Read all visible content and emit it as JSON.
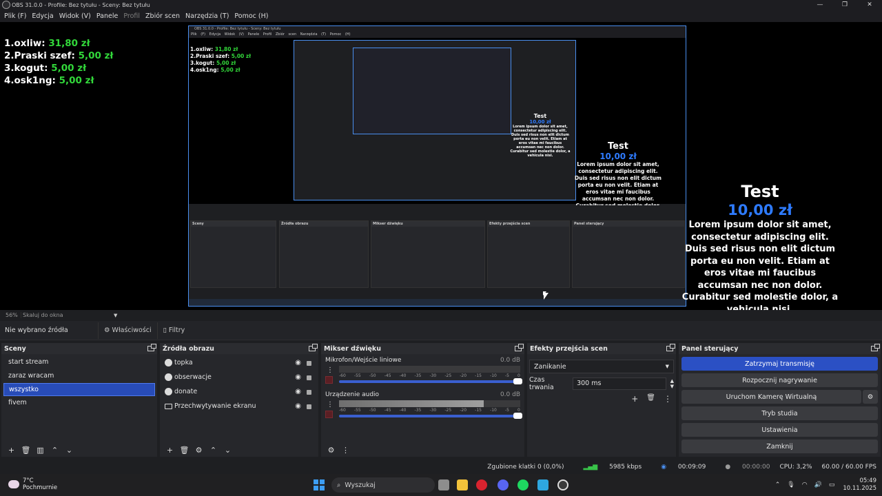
{
  "window": {
    "title": "OBS 31.0.0 - Profile: Bez tytułu - Sceny: Bez tytułu",
    "controls": [
      "—",
      "❐",
      "✕"
    ]
  },
  "menu": [
    "Plik (F)",
    "Edycja",
    "Widok (V)",
    "Panele",
    "Profil",
    "Zbiór scen",
    "Narzędzia (T)",
    "Pomoc (H)"
  ],
  "preview": {
    "leaderboard": [
      {
        "label": "1.oxliw:",
        "amount": "31,80 zł"
      },
      {
        "label": "2.Praski szef:",
        "amount": "5,00 zł"
      },
      {
        "label": "3.kogut:",
        "amount": "5,00 zł"
      },
      {
        "label": "4.osk1ng:",
        "amount": "5,00 zł"
      }
    ],
    "alert": {
      "title": "Test",
      "value": "10,00 zł",
      "message": "Lorem ipsum dolor sit amet, consectetur adipiscing elit. Duis sed risus non elit dictum porta eu non velit. Etiam at eros vitae mi faucibus accumsan nec non dolor. Curabitur sed molestie dolor, a vehicula nisi."
    }
  },
  "zoom": {
    "percent": "56%",
    "scale_label": "Skaluj do okna"
  },
  "source_toolbar": {
    "no_source": "Nie wybrano źródła",
    "properties": "Właściwości",
    "filters": "Filtry"
  },
  "scenes": {
    "title": "Sceny",
    "items": [
      "start stream",
      "zaraz wracam",
      "wszystko",
      "fivem"
    ],
    "selected": 2
  },
  "sources": {
    "title": "Źródła obrazu",
    "items": [
      "topka",
      "obserwacje",
      "donate",
      "Przechwytywanie ekranu"
    ]
  },
  "mixer": {
    "title": "Mikser dźwięku",
    "channels": [
      {
        "name": "Mikrofon/Wejście liniowe",
        "db": "0.0 dB",
        "level": 0
      },
      {
        "name": "Urządzenie audio",
        "db": "0.0 dB",
        "level": 0.8
      }
    ],
    "ticks": [
      "-60",
      "-55",
      "-50",
      "-45",
      "-40",
      "-35",
      "-30",
      "-25",
      "-20",
      "-15",
      "-10",
      "-5",
      "0"
    ]
  },
  "transitions": {
    "title": "Efekty przejścia scen",
    "type": "Zanikanie",
    "duration_label": "Czas trwania",
    "duration_value": "300 ms"
  },
  "controls": {
    "title": "Panel sterujący",
    "buttons": [
      "Zatrzymaj transmisję",
      "Rozpocznij nagrywanie",
      "Uruchom Kamerę Wirtualną",
      "Tryb studia",
      "Ustawienia",
      "Zamknij"
    ]
  },
  "status": {
    "dropped": "Zgubione klatki 0 (0,0%)",
    "bitrate": "5985 kbps",
    "stream_time": "00:09:09",
    "rec_time": "00:00:00",
    "cpu": "CPU: 3,2%",
    "fps": "60.00 / 60.00 FPS"
  },
  "taskbar": {
    "temp": "7°C",
    "weather": "Pochmurnie",
    "search_placeholder": "Wyszukaj",
    "time": "05:49",
    "date": "10.11.2025"
  },
  "colors": {
    "accent": "#2b50c4",
    "money": "#32d83a",
    "alert_value": "#2e7bff"
  }
}
